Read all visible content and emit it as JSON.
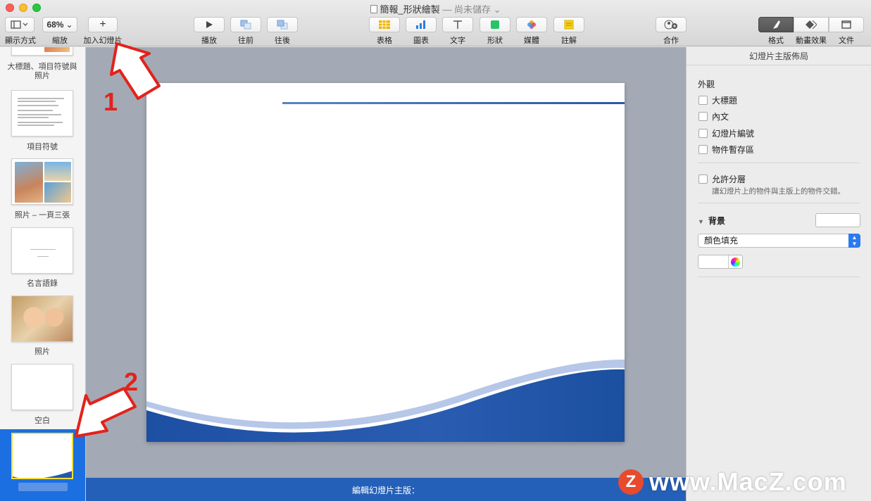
{
  "window": {
    "title": "簡報_形狀繪製",
    "subtitle": "— 尚未儲存 ⌄"
  },
  "toolbar": {
    "view_label": "顯示方式",
    "zoom_value": "68%",
    "zoom_label": "縮放",
    "add_slide_label": "加入幻燈片",
    "play_label": "播放",
    "backward_label": "往前",
    "forward_label": "往後",
    "table_label": "表格",
    "chart_label": "圖表",
    "text_label": "文字",
    "shape_label": "形狀",
    "media_label": "媒體",
    "comment_label": "註解",
    "collaborate_label": "合作",
    "format_label": "格式",
    "animate_label": "動畫效果",
    "document_label": "文件"
  },
  "navigator": {
    "layouts": [
      {
        "label": "大標題、項目符號與照片"
      },
      {
        "label": "項目符號"
      },
      {
        "label": "照片 – 一頁三張"
      },
      {
        "label": "名言語錄"
      },
      {
        "label": "照片"
      },
      {
        "label": "空白"
      }
    ],
    "selected_label": ""
  },
  "canvas": {
    "bottom_bar_text": "編輯幻燈片主版："
  },
  "inspector": {
    "title": "幻燈片主版佈局",
    "appearance_title": "外觀",
    "appearance_options": [
      {
        "label": "大標題"
      },
      {
        "label": "內文"
      },
      {
        "label": "幻燈片編號"
      },
      {
        "label": "物件暫存區"
      }
    ],
    "allow_layering_label": "允許分層",
    "allow_layering_hint": "讓幻燈片上的物件與主版上的物件交錯。",
    "background_title": "背景",
    "fill_type": "顏色填充"
  },
  "annotations": {
    "step1": "1",
    "step2": "2"
  },
  "watermark": {
    "logo_letter": "Z",
    "text": "www.MacZ.com"
  },
  "colors": {
    "accent": "#1c6fe0",
    "slide_wave": "#1f4f9c",
    "annotation": "#e3221b"
  }
}
